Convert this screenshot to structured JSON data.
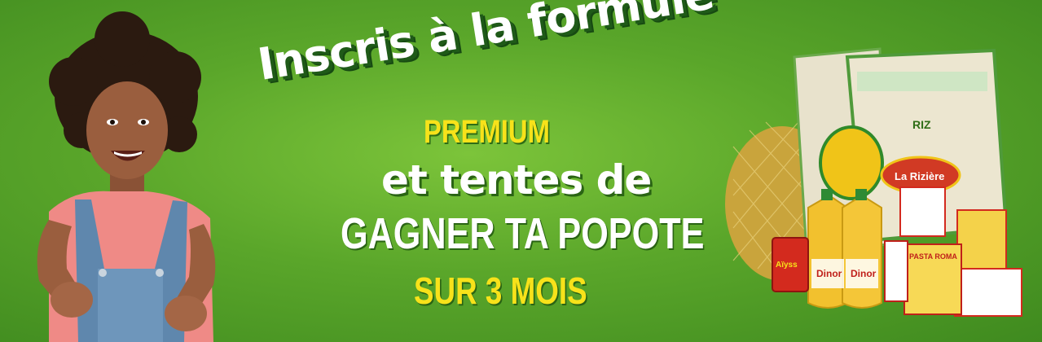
{
  "headline": {
    "line1": "Inscris à la formule",
    "line2": "PREMIUM",
    "line3": "et tentes de",
    "line4": "GAGNER TA POPOTE",
    "line5": "SUR 3 MOIS"
  },
  "products": {
    "rice_bag_label": "La Rizière",
    "rice_bag_text": "RIZ",
    "oil_brand": "Dinor",
    "tomato_brand": "Aïyss",
    "pasta_brand": "PASTA ROMA"
  },
  "colors": {
    "background": "#5aa62a",
    "headline_white": "#ffffff",
    "headline_yellow": "#f7e21a",
    "shadow_green": "#1f5a18"
  }
}
